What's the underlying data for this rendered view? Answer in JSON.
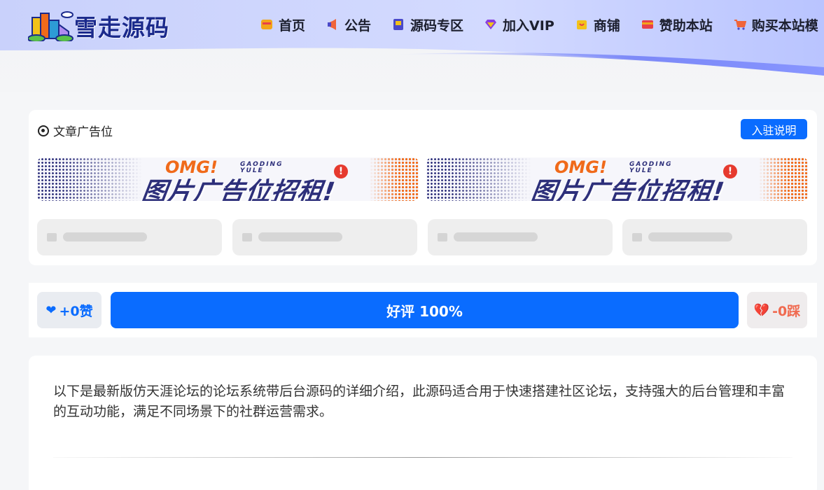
{
  "site": {
    "logo_text": "雪走源码",
    "brand_color": "#1b2a8c",
    "accent": "#0a6cff"
  },
  "nav": {
    "items": [
      {
        "label": "首页",
        "icon": "home-icon",
        "color": "#f2a51a"
      },
      {
        "label": "公告",
        "icon": "megaphone-icon",
        "color": "#f0643a"
      },
      {
        "label": "源码专区",
        "icon": "book-icon",
        "color": "#4a49c9"
      },
      {
        "label": "加入VIP",
        "icon": "diamond-icon",
        "color": "#8a3ee0"
      },
      {
        "label": "商铺",
        "icon": "shop-icon",
        "color": "#f2c21a"
      },
      {
        "label": "赞助本站",
        "icon": "card-icon",
        "color": "#e8404a"
      },
      {
        "label": "购买本站模",
        "icon": "cart-icon",
        "color": "#f0643a"
      }
    ]
  },
  "ad": {
    "title": "文章广告位",
    "join_label": "入驻说明",
    "banners": [
      {
        "omg": "OMG!",
        "sub": "GAODING YULE",
        "main": "图片广告位招租!"
      },
      {
        "omg": "OMG!",
        "sub": "GAODING YULE",
        "main": "图片广告位招租!"
      }
    ]
  },
  "vote": {
    "like_label": "+0赞",
    "score_label": "好评 100%",
    "dislike_label": "-0踩"
  },
  "article": {
    "intro": "以下是最新版仿天涯论坛的论坛系统带后台源码的详细介绍，此源码适合用于快速搭建社区论坛，支持强大的后台管理和丰富的互动功能，满足不同场景下的社群运营需求。"
  }
}
